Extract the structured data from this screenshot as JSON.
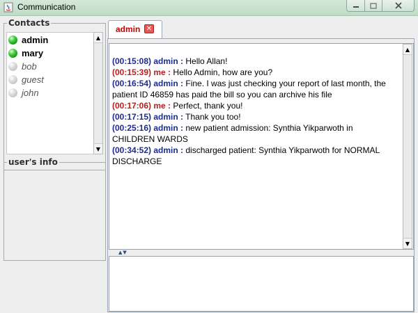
{
  "window": {
    "title": "Communication"
  },
  "contacts": {
    "legend": "Contacts",
    "items": [
      {
        "name": "admin",
        "status": "online"
      },
      {
        "name": "mary",
        "status": "online"
      },
      {
        "name": "bob",
        "status": "offline"
      },
      {
        "name": "guest",
        "status": "offline"
      },
      {
        "name": "john",
        "status": "offline"
      }
    ]
  },
  "user_info": {
    "legend": "user's info"
  },
  "tab": {
    "label": "admin",
    "close_icon": "close-icon"
  },
  "messages": [
    {
      "time": "(00:15:08)",
      "sender": "admin :",
      "role": "admin",
      "text": " Hello Allan!"
    },
    {
      "time": "(00:15:39)",
      "sender": "me :",
      "role": "me",
      "text": " Hello Admin, how are you?"
    },
    {
      "time": "(00:16:54)",
      "sender": "admin :",
      "role": "admin",
      "text": " Fine. I was just checking your report of last month, the patient ID 46859 has paid the bill so you can archive his file"
    },
    {
      "time": "(00:17:06)",
      "sender": "me :",
      "role": "me",
      "text": " Perfect, thank you!"
    },
    {
      "time": "(00:17:15)",
      "sender": "admin :",
      "role": "admin",
      "text": " Thank you too!"
    },
    {
      "time": "(00:25:16)",
      "sender": "admin :",
      "role": "admin",
      "text": " new patient admission: Synthia Yikparwoth in CHILDREN WARDS"
    },
    {
      "time": "(00:34:52)",
      "sender": "admin :",
      "role": "admin",
      "text": " discharged patient: Synthia Yikparwoth for NORMAL DISCHARGE"
    }
  ],
  "colors": {
    "admin": "#1c2c8c",
    "me": "#b22222",
    "online": "#22aa22",
    "offline": "#b4b4b4",
    "tab_label": "#cc0000"
  }
}
